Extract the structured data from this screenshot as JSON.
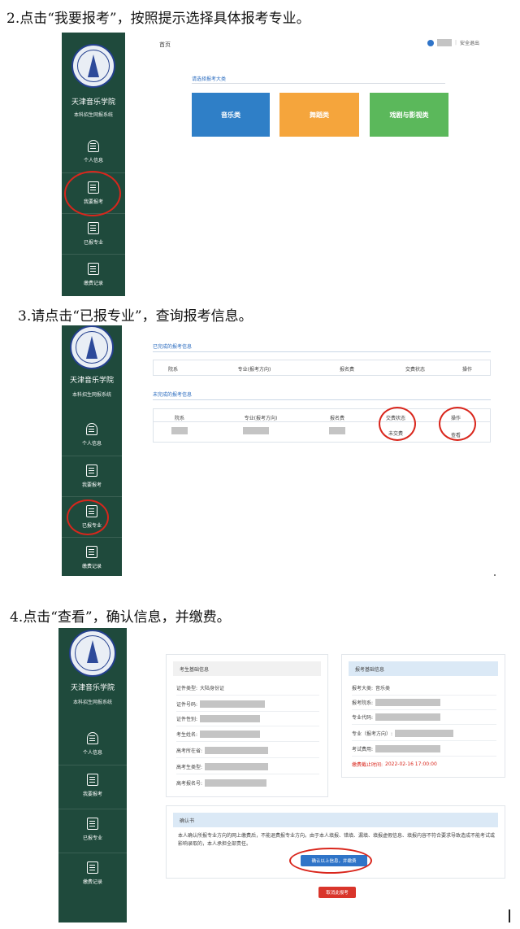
{
  "headings": {
    "step2": "2.点击“我要报考”，按照提示选择具体报考专业。",
    "step3": "3.请点击“已报专业”，查询报考信息。",
    "step4": "4.点击“查看”，确认信息，并缴费。"
  },
  "sidebar": {
    "school_name": "天津音乐学院",
    "system_name": "本科招生网报系统",
    "items": [
      {
        "label": "个人信息",
        "icon": "person-icon"
      },
      {
        "label": "我要报考",
        "icon": "edit-icon"
      },
      {
        "label": "已报专业",
        "icon": "document-icon"
      },
      {
        "label": "缴费记录",
        "icon": "receipt-icon"
      }
    ]
  },
  "screen1": {
    "breadcrumb": "首页",
    "logout": "安全退出",
    "category_prompt": "请选择报考大类",
    "categories": [
      {
        "label": "音乐类",
        "color": "#2f7fc7"
      },
      {
        "label": "舞蹈类",
        "color": "#f5a53c"
      },
      {
        "label": "戏剧与影视类",
        "color": "#5bb85b"
      }
    ]
  },
  "screen2": {
    "completed_title": "已完成的报考信息",
    "pending_title": "未完成的报考信息",
    "columns": [
      "院系",
      "专业(报考方向)",
      "报名费",
      "交费状态",
      "操作"
    ],
    "pending_row": {
      "status": "未交费",
      "action": "查看"
    }
  },
  "screen3": {
    "student_card_title": "考生基础信息",
    "student_fields": [
      {
        "label": "证件类型:",
        "value": "大陆身份证"
      },
      {
        "label": "证件号码:",
        "value": ""
      },
      {
        "label": "证件性别:",
        "value": ""
      },
      {
        "label": "考生姓名:",
        "value": ""
      },
      {
        "label": "高考所在省:",
        "value": ""
      },
      {
        "label": "高考生类型:",
        "value": ""
      },
      {
        "label": "高考报名号:",
        "value": ""
      }
    ],
    "apply_card_title": "报考基础信息",
    "apply_fields": [
      {
        "label": "报考大类:",
        "value": "音乐类"
      },
      {
        "label": "报考院系:",
        "value": ""
      },
      {
        "label": "专业代码:",
        "value": ""
      },
      {
        "label": "专业（报考方向）:",
        "value": ""
      },
      {
        "label": "考试费用:",
        "value": ""
      }
    ],
    "deadline_label": "缴费截止时间:",
    "deadline_value": "2022-02-16 17:00:00",
    "notice_title": "确认书",
    "notice_text": "本人确认所报专业方向的网上缴费后，不能退费报专业方向。由于本人填报、错填、漏填、填报虚假信息、填报内容不符合要求导致造成不能考试或影响录取的，本人承担全部责任。",
    "confirm_button": "确认以上信息，并缴费",
    "cancel_button": "取消此报考"
  }
}
